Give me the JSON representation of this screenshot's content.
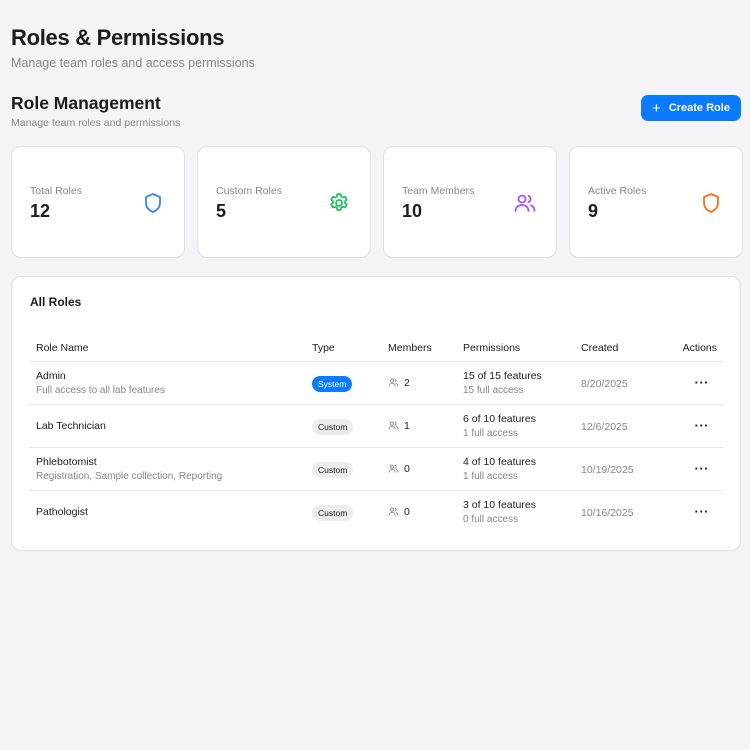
{
  "page": {
    "title": "Roles & Permissions",
    "subtitle": "Manage team roles and access permissions"
  },
  "section": {
    "title": "Role Management",
    "subtitle": "Manage team roles and permissions",
    "create_label": "Create Role"
  },
  "stats": [
    {
      "label": "Total Roles",
      "value": "12",
      "icon": "shield-icon",
      "color": "#3b82f6"
    },
    {
      "label": "Custom Roles",
      "value": "5",
      "icon": "gear-icon",
      "color": "#22c55e"
    },
    {
      "label": "Team Members",
      "value": "10",
      "icon": "users-icon",
      "color": "#a855f7"
    },
    {
      "label": "Active Roles",
      "value": "9",
      "icon": "shield-icon",
      "color": "#f97316"
    }
  ],
  "roles": {
    "title": "All Roles",
    "columns": [
      "Role Name",
      "Type",
      "Members",
      "Permissions",
      "Created",
      "Actions"
    ],
    "rows": [
      {
        "name": "Admin",
        "desc": "Full access to all lab features",
        "type": "System",
        "members": "2",
        "perms": "15 of 15 features",
        "perms_sub": "15 full access",
        "created": "8/20/2025",
        "actions": "···"
      },
      {
        "name": "Lab Technician",
        "desc": "",
        "type": "Custom",
        "members": "1",
        "perms": "6 of 10 features",
        "perms_sub": "1 full access",
        "created": "12/6/2025",
        "actions": "···"
      },
      {
        "name": "Phlebotomist",
        "desc": "Registration, Sample collection, Reporting",
        "type": "Custom",
        "members": "0",
        "perms": "4 of 10 features",
        "perms_sub": "1 full access",
        "created": "10/19/2025",
        "actions": "···"
      },
      {
        "name": "Pathologist",
        "desc": "",
        "type": "Custom",
        "members": "0",
        "perms": "3 of 10 features",
        "perms_sub": "0 full access",
        "created": "10/16/2025",
        "actions": "···"
      }
    ]
  }
}
